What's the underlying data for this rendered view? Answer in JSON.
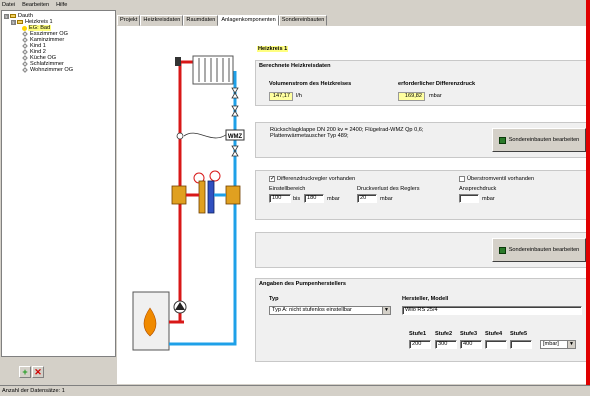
{
  "menu": [
    "Datei",
    "Bearbeiten",
    "Hilfe"
  ],
  "tree": {
    "root": "Dauth",
    "circuit": "Heizkreis 1",
    "rooms": [
      "EG: Bad",
      "Esszimmer OG",
      "Kaminzimmer",
      "Kind 1",
      "Kind 2",
      "Küche OG",
      "Schlafzimmer",
      "Wohnzimmer OG"
    ],
    "expander_symbol": "⊟"
  },
  "buttons": {
    "add": "+",
    "delete": "✕"
  },
  "status": "Anzahl der Datensätze: 1",
  "tabs": [
    "Projekt",
    "Heizkreisdaten",
    "Raumdaten",
    "Anlagenkomponenten",
    "Sondereinbauten"
  ],
  "active_tab": 3,
  "panel": {
    "heading": "Heizkreis 1",
    "calc_title": "Berechnete Heizkreisdaten",
    "flow_label": "Volumenstrom des Heizkreises",
    "flow_value": "147,17",
    "flow_unit": "l/h",
    "dp_label": "erforderlicher Differenzdruck",
    "dp_value": "169,82",
    "dp_unit": "mbar",
    "components_text": "Rückschlagklappe DN 200 kv = 2400;  Flügelrad-WMZ Qp 0,6; Plattenwärmetauscher Typ 489;",
    "special_button": "Sondereinbauten bearbeiten",
    "diff_reg_label": "Differenzdruckregler vorhanden",
    "overflow_label": "Überstromventil vorhanden",
    "range_label": "Einstellbereich",
    "range_from": "100",
    "range_sep": "bis",
    "range_to": "180",
    "range_unit": "mbar",
    "loss_label": "Druckverlust des Reglers",
    "loss_value": "20",
    "loss_unit": "mbar",
    "resp_label": "Ansprechdruck",
    "resp_value": "",
    "resp_unit": "mbar",
    "special_button2": "Sondereinbauten bearbeiten",
    "pump_title": "Angaben des Pumpenherstellers",
    "type_label": "Typ",
    "type_value": "Typ A: nicht stufenlos einstellbar",
    "maker_label": "Hersteller, Modell",
    "maker_value": "Wilo  RS 25/4",
    "stages": [
      "Stufe1",
      "Stufe2",
      "Stufe3",
      "Stufe4",
      "Stufe5"
    ],
    "stage_values": [
      "200",
      "300",
      "400",
      "",
      ""
    ],
    "stage_unit": "[mbar]",
    "wmz": "WMZ"
  },
  "colors": {
    "accent_red": "#e00000",
    "flow_red": "#d81818",
    "return_blue": "#1ea0e8",
    "highlight": "#ffff80"
  },
  "icons": [
    "folder-icon",
    "room-icon",
    "radiator-icon",
    "pump-icon",
    "flame-icon",
    "valve-icon",
    "edit-icon"
  ]
}
